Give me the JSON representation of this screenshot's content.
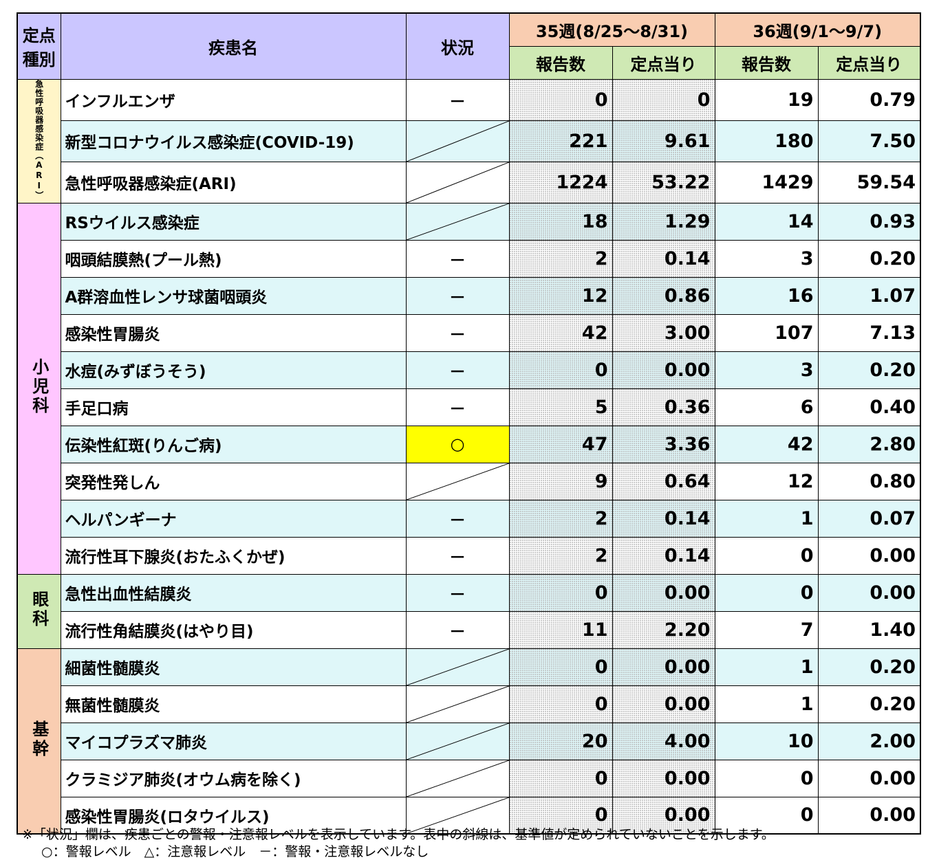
{
  "header": {
    "type_label_1": "定点",
    "type_label_2": "種別",
    "disease_label": "疾患名",
    "status_label": "状況",
    "week35_label": "35週(8/25～8/31)",
    "week36_label": "36週(9/1～9/7)",
    "reports_label": "報告数",
    "per_site_label": "定点当り"
  },
  "groups": [
    {
      "label": "急性呼吸器感染症（ARI）",
      "rows": [
        {
          "disease": "インフルエンザ",
          "status": "－",
          "w35_reports": "0",
          "w35_per": "0",
          "w36_reports": "19",
          "w36_per": "0.79"
        },
        {
          "disease": "新型コロナウイルス感染症(COVID-19)",
          "status": "",
          "w35_reports": "221",
          "w35_per": "9.61",
          "w36_reports": "180",
          "w36_per": "7.50"
        },
        {
          "disease": "急性呼吸器感染症(ARI)",
          "status": "",
          "w35_reports": "1224",
          "w35_per": "53.22",
          "w36_reports": "1429",
          "w36_per": "59.54"
        }
      ]
    },
    {
      "label": "小児科",
      "rows": [
        {
          "disease": "RSウイルス感染症",
          "status": "",
          "w35_reports": "18",
          "w35_per": "1.29",
          "w36_reports": "14",
          "w36_per": "0.93"
        },
        {
          "disease": "咽頭結膜熱(プール熱)",
          "status": "－",
          "w35_reports": "2",
          "w35_per": "0.14",
          "w36_reports": "3",
          "w36_per": "0.20"
        },
        {
          "disease": "A群溶血性レンサ球菌咽頭炎",
          "status": "－",
          "w35_reports": "12",
          "w35_per": "0.86",
          "w36_reports": "16",
          "w36_per": "1.07"
        },
        {
          "disease": "感染性胃腸炎",
          "status": "－",
          "w35_reports": "42",
          "w35_per": "3.00",
          "w36_reports": "107",
          "w36_per": "7.13"
        },
        {
          "disease": "水痘(みずぼうそう)",
          "status": "－",
          "w35_reports": "0",
          "w35_per": "0.00",
          "w36_reports": "3",
          "w36_per": "0.20"
        },
        {
          "disease": "手足口病",
          "status": "－",
          "w35_reports": "5",
          "w35_per": "0.36",
          "w36_reports": "6",
          "w36_per": "0.40"
        },
        {
          "disease": "伝染性紅斑(りんご病)",
          "status": "○",
          "w35_reports": "47",
          "w35_per": "3.36",
          "w36_reports": "42",
          "w36_per": "2.80"
        },
        {
          "disease": "突発性発しん",
          "status": "",
          "w35_reports": "9",
          "w35_per": "0.64",
          "w36_reports": "12",
          "w36_per": "0.80"
        },
        {
          "disease": "ヘルパンギーナ",
          "status": "－",
          "w35_reports": "2",
          "w35_per": "0.14",
          "w36_reports": "1",
          "w36_per": "0.07"
        },
        {
          "disease": "流行性耳下腺炎(おたふくかぜ)",
          "status": "－",
          "w35_reports": "2",
          "w35_per": "0.14",
          "w36_reports": "0",
          "w36_per": "0.00"
        }
      ]
    },
    {
      "label": "眼科",
      "rows": [
        {
          "disease": "急性出血性結膜炎",
          "status": "－",
          "w35_reports": "0",
          "w35_per": "0.00",
          "w36_reports": "0",
          "w36_per": "0.00"
        },
        {
          "disease": "流行性角結膜炎(はやり目)",
          "status": "－",
          "w35_reports": "11",
          "w35_per": "2.20",
          "w36_reports": "7",
          "w36_per": "1.40"
        }
      ]
    },
    {
      "label": "基幹",
      "rows": [
        {
          "disease": "細菌性髄膜炎",
          "status": "",
          "w35_reports": "0",
          "w35_per": "0.00",
          "w36_reports": "1",
          "w36_per": "0.20"
        },
        {
          "disease": "無菌性髄膜炎",
          "status": "",
          "w35_reports": "0",
          "w35_per": "0.00",
          "w36_reports": "1",
          "w36_per": "0.20"
        },
        {
          "disease": "マイコプラズマ肺炎",
          "status": "",
          "w35_reports": "20",
          "w35_per": "4.00",
          "w36_reports": "10",
          "w36_per": "2.00"
        },
        {
          "disease": "クラミジア肺炎(オウム病を除く)",
          "status": "",
          "w35_reports": "0",
          "w35_per": "0.00",
          "w36_reports": "0",
          "w36_per": "0.00"
        },
        {
          "disease": "感染性胃腸炎(ロタウイルス)",
          "status": "",
          "w35_reports": "0",
          "w35_per": "0.00",
          "w36_reports": "0",
          "w36_per": "0.00"
        }
      ]
    }
  ],
  "notes": {
    "line1": "※「状況」欄は、疾患ごとの警報・注意報レベルを表示しています。表中の斜線は、基準値が定められていないことを示します。",
    "line2": "○：警報レベル　△：注意報レベル　－：警報・注意報レベルなし"
  },
  "colors": {
    "alert": "#ffff00",
    "row_cyan": "#dff7f9"
  }
}
